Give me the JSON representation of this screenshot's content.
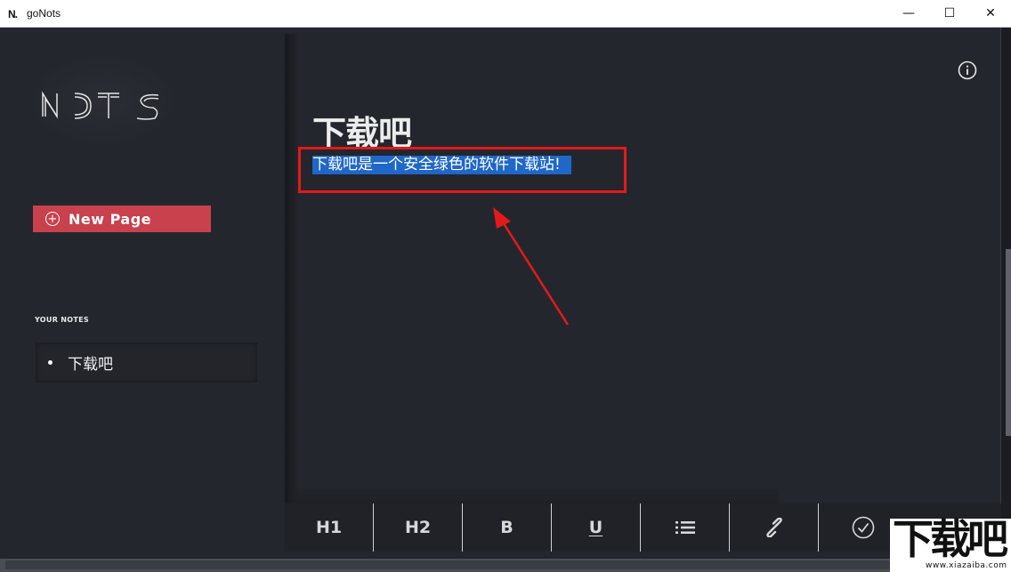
{
  "window": {
    "app_icon": "N.",
    "title": "goNots",
    "controls": {
      "minimize": "—",
      "maximize": "☐",
      "close": "✕"
    }
  },
  "sidebar": {
    "logo_icon": "nots-logo",
    "new_page_label": "New Page",
    "notes_heading": "YOUR NOTES",
    "notes": [
      {
        "label": "下载吧"
      }
    ]
  },
  "editor": {
    "title": "下载吧",
    "body": "下载吧是一个安全绿色的软件下载站!",
    "info_icon": "info-icon"
  },
  "toolbar": {
    "h1": "H1",
    "h2": "H2",
    "bold": "B",
    "underline": "U",
    "list_icon": "list-icon",
    "link_icon": "link-icon",
    "save_icon": "check-circle-icon"
  },
  "watermark": {
    "big": "下载吧",
    "small": "www.xiazaiba.com"
  },
  "colors": {
    "background": "#24262d",
    "accent": "#c8414d",
    "selection": "#1f67c9",
    "annotation": "#e31a1a"
  }
}
